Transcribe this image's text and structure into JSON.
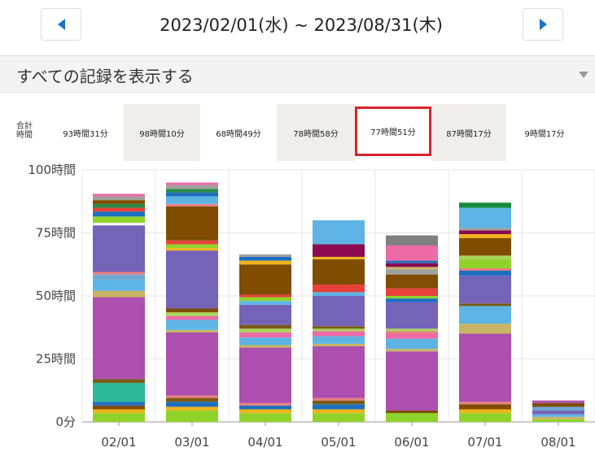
{
  "header": {
    "date_range": "2023/02/01(水) ~ 2023/08/31(木)",
    "prev_icon": "triangle-left-icon",
    "next_icon": "triangle-right-icon",
    "accent_color": "#1a73c9"
  },
  "filter": {
    "selected": "すべての記録を表示する",
    "caret_icon": "caret-down-icon"
  },
  "totals": {
    "label": "合計時間",
    "cells": [
      {
        "label": "93時間31分"
      },
      {
        "label": "98時間10分"
      },
      {
        "label": "68時間49分"
      },
      {
        "label": "78時間58分"
      },
      {
        "label": "77時間51分",
        "selected": true
      },
      {
        "label": "87時間17分"
      },
      {
        "label": "9時間17分"
      }
    ]
  },
  "chart_data": {
    "type": "bar",
    "stacked": true,
    "categories": [
      "02/01",
      "03/01",
      "04/01",
      "05/01",
      "06/01",
      "07/01",
      "08/01"
    ],
    "y_ticks": [
      "0分",
      "25時間",
      "50時間",
      "75時間",
      "100時間"
    ],
    "ylim": [
      0,
      100
    ],
    "grid": true,
    "segments": [
      [
        [
          3.5,
          "#8fd32a"
        ],
        [
          1.5,
          "#f0b41c"
        ],
        [
          1.5,
          "#7f4c00"
        ],
        [
          1.5,
          "#1e6fbf"
        ],
        [
          7.5,
          "#2eb89a"
        ],
        [
          1.5,
          "#7a5a14"
        ],
        [
          32.5,
          "#ac4faf"
        ],
        [
          2.5,
          "#c8b464"
        ],
        [
          4.5,
          "#5db4e4"
        ],
        [
          2,
          "#6fa8d4"
        ],
        [
          1,
          "#e88080"
        ],
        [
          18.5,
          "#7563b8"
        ],
        [
          1,
          "#f3f3f3"
        ],
        [
          2.5,
          "#8fd32a"
        ],
        [
          2,
          "#1e6fbf"
        ],
        [
          1.5,
          "#e8403a"
        ],
        [
          1.5,
          "#2a8a4a"
        ],
        [
          1.5,
          "#7f4c00"
        ],
        [
          1.5,
          "#a0a0a0"
        ],
        [
          1,
          "#ec6aa5"
        ]
      ],
      [
        [
          4.5,
          "#8fd32a"
        ],
        [
          1.5,
          "#f0b41c"
        ],
        [
          2,
          "#1e6fbf"
        ],
        [
          1.5,
          "#7a5a14"
        ],
        [
          1,
          "#e88080"
        ],
        [
          25,
          "#ac4faf"
        ],
        [
          1,
          "#c8b464"
        ],
        [
          4,
          "#5db4e4"
        ],
        [
          1.5,
          "#ec6aa5"
        ],
        [
          1.5,
          "#a8d45a"
        ],
        [
          1.5,
          "#7f4c00"
        ],
        [
          23,
          "#7563b8"
        ],
        [
          1,
          "#f0b41c"
        ],
        [
          1.5,
          "#8fd32a"
        ],
        [
          1.5,
          "#e8403a"
        ],
        [
          13.5,
          "#7f4c00"
        ],
        [
          1,
          "#e88080"
        ],
        [
          3,
          "#5db4e4"
        ],
        [
          1.5,
          "#1e6fbf"
        ],
        [
          1.5,
          "#2a8a4a"
        ],
        [
          1.5,
          "#a0a0a0"
        ],
        [
          1,
          "#ec6aa5"
        ]
      ],
      [
        [
          3.5,
          "#8fd32a"
        ],
        [
          1.5,
          "#f0b41c"
        ],
        [
          1.5,
          "#1e6fbf"
        ],
        [
          1,
          "#e88080"
        ],
        [
          22,
          "#ac4faf"
        ],
        [
          1,
          "#c8b464"
        ],
        [
          3,
          "#5db4e4"
        ],
        [
          2,
          "#ec6aa5"
        ],
        [
          1.5,
          "#a8d45a"
        ],
        [
          1.5,
          "#7a5a14"
        ],
        [
          8,
          "#7563b8"
        ],
        [
          1.5,
          "#5db4e4"
        ],
        [
          1.5,
          "#8fd32a"
        ],
        [
          1,
          "#e8403a"
        ],
        [
          12,
          "#7f4c00"
        ],
        [
          1.5,
          "#f0b41c"
        ],
        [
          1.5,
          "#1e6fbf"
        ],
        [
          1,
          "#a0a0a0"
        ]
      ],
      [
        [
          3.5,
          "#8fd32a"
        ],
        [
          1.5,
          "#f0b41c"
        ],
        [
          2,
          "#1e6fbf"
        ],
        [
          1.5,
          "#7a5a14"
        ],
        [
          1,
          "#e88080"
        ],
        [
          20.5,
          "#ac4faf"
        ],
        [
          1,
          "#c8b464"
        ],
        [
          3,
          "#5db4e4"
        ],
        [
          2,
          "#ec6aa5"
        ],
        [
          1,
          "#a8d45a"
        ],
        [
          1,
          "#7a5a14"
        ],
        [
          12,
          "#7563b8"
        ],
        [
          1.5,
          "#5db4e4"
        ],
        [
          3,
          "#e8403a"
        ],
        [
          10,
          "#7f4c00"
        ],
        [
          1,
          "#f0b41c"
        ],
        [
          5,
          "#8b0a50"
        ],
        [
          9.5,
          "#5db4e4"
        ]
      ],
      [
        [
          3.5,
          "#8fd32a"
        ],
        [
          1,
          "#7f4c00"
        ],
        [
          23.5,
          "#ac4faf"
        ],
        [
          1,
          "#c8b464"
        ],
        [
          4,
          "#5db4e4"
        ],
        [
          2,
          "#ec6aa5"
        ],
        [
          1,
          "#e88080"
        ],
        [
          1,
          "#a8d45a"
        ],
        [
          10.5,
          "#7563b8"
        ],
        [
          1.5,
          "#1e6fbf"
        ],
        [
          1,
          "#8fd32a"
        ],
        [
          3,
          "#e8403a"
        ],
        [
          1.5,
          "#7f4c00"
        ],
        [
          4,
          "#7f4c00"
        ],
        [
          2,
          "#a0a0a0"
        ],
        [
          1,
          "#c8b464"
        ],
        [
          1.5,
          "#8b0a50"
        ],
        [
          1,
          "#1e6fbf"
        ],
        [
          6,
          "#ec6aa5"
        ],
        [
          4,
          "#808080"
        ]
      ],
      [
        [
          3.5,
          "#8fd32a"
        ],
        [
          1.5,
          "#f0b41c"
        ],
        [
          2,
          "#7f4c00"
        ],
        [
          1,
          "#e88080"
        ],
        [
          27,
          "#ac4faf"
        ],
        [
          4,
          "#c8b464"
        ],
        [
          5,
          "#5db4e4"
        ],
        [
          2,
          "#5db4e4"
        ],
        [
          1,
          "#7a5a14"
        ],
        [
          11,
          "#7563b8"
        ],
        [
          2,
          "#1e6fbf"
        ],
        [
          1,
          "#e88080"
        ],
        [
          3.5,
          "#8fd32a"
        ],
        [
          1.5,
          "#a8d45a"
        ],
        [
          7,
          "#7f4c00"
        ],
        [
          1.5,
          "#f0b41c"
        ],
        [
          1.5,
          "#8b0a50"
        ],
        [
          1,
          "#a0a0a0"
        ],
        [
          8,
          "#5db4e4"
        ],
        [
          2,
          "#1a8a3a"
        ]
      ],
      [
        [
          1,
          "#8fd32a"
        ],
        [
          1,
          "#c8b464"
        ],
        [
          1,
          "#5db4e4"
        ],
        [
          1.5,
          "#7563b8"
        ],
        [
          1.5,
          "#6fa8d4"
        ],
        [
          1.5,
          "#7f4c00"
        ],
        [
          1,
          "#ac4faf"
        ]
      ]
    ]
  }
}
